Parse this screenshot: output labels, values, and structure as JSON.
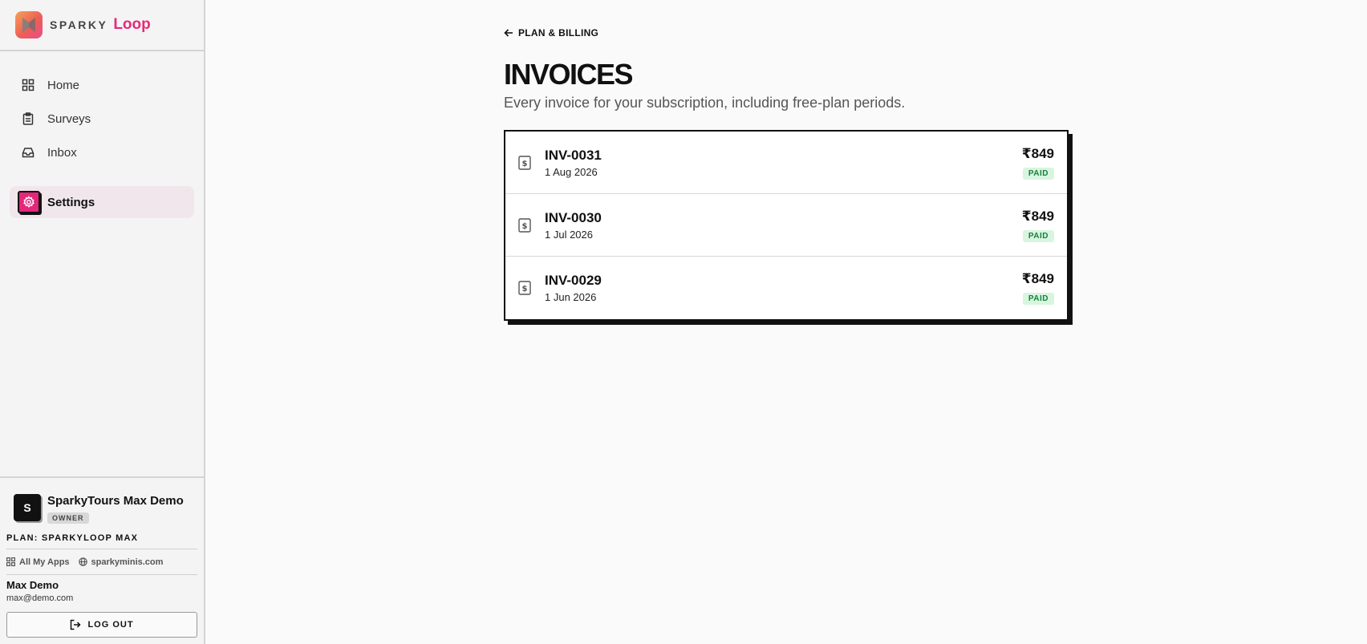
{
  "brand": {
    "sparky": "SPARKY",
    "loop": "Loop",
    "accent": "#e8287a"
  },
  "nav": {
    "items": [
      {
        "label": "Home",
        "icon": "dashboard-icon"
      },
      {
        "label": "Surveys",
        "icon": "clipboard-icon"
      },
      {
        "label": "Inbox",
        "icon": "inbox-icon"
      },
      {
        "label": "Settings",
        "icon": "gear-icon",
        "active": true
      }
    ]
  },
  "org": {
    "avatar": "S",
    "name": "SparkyTours Max Demo",
    "role": "OWNER"
  },
  "plan": {
    "label": "PLAN: SPARKYLOOP MAX"
  },
  "links": {
    "apps": "All My Apps",
    "site": "sparkyminis.com"
  },
  "user": {
    "name": "Max Demo",
    "email": "max@demo.com"
  },
  "logout": {
    "label": "LOG OUT"
  },
  "main": {
    "back_label": "PLAN & BILLING",
    "title": "INVOICES",
    "subtitle": "Every invoice for your subscription, including free-plan periods.",
    "invoices": [
      {
        "id": "INV-0031",
        "date": "1 Aug 2026",
        "amount": "₹849",
        "status": "PAID"
      },
      {
        "id": "INV-0030",
        "date": "1 Jul 2026",
        "amount": "₹849",
        "status": "PAID"
      },
      {
        "id": "INV-0029",
        "date": "1 Jun 2026",
        "amount": "₹849",
        "status": "PAID"
      }
    ]
  },
  "colors": {
    "paid_bg": "#d8f5df",
    "paid_text": "#17803d",
    "border": "#111111"
  }
}
